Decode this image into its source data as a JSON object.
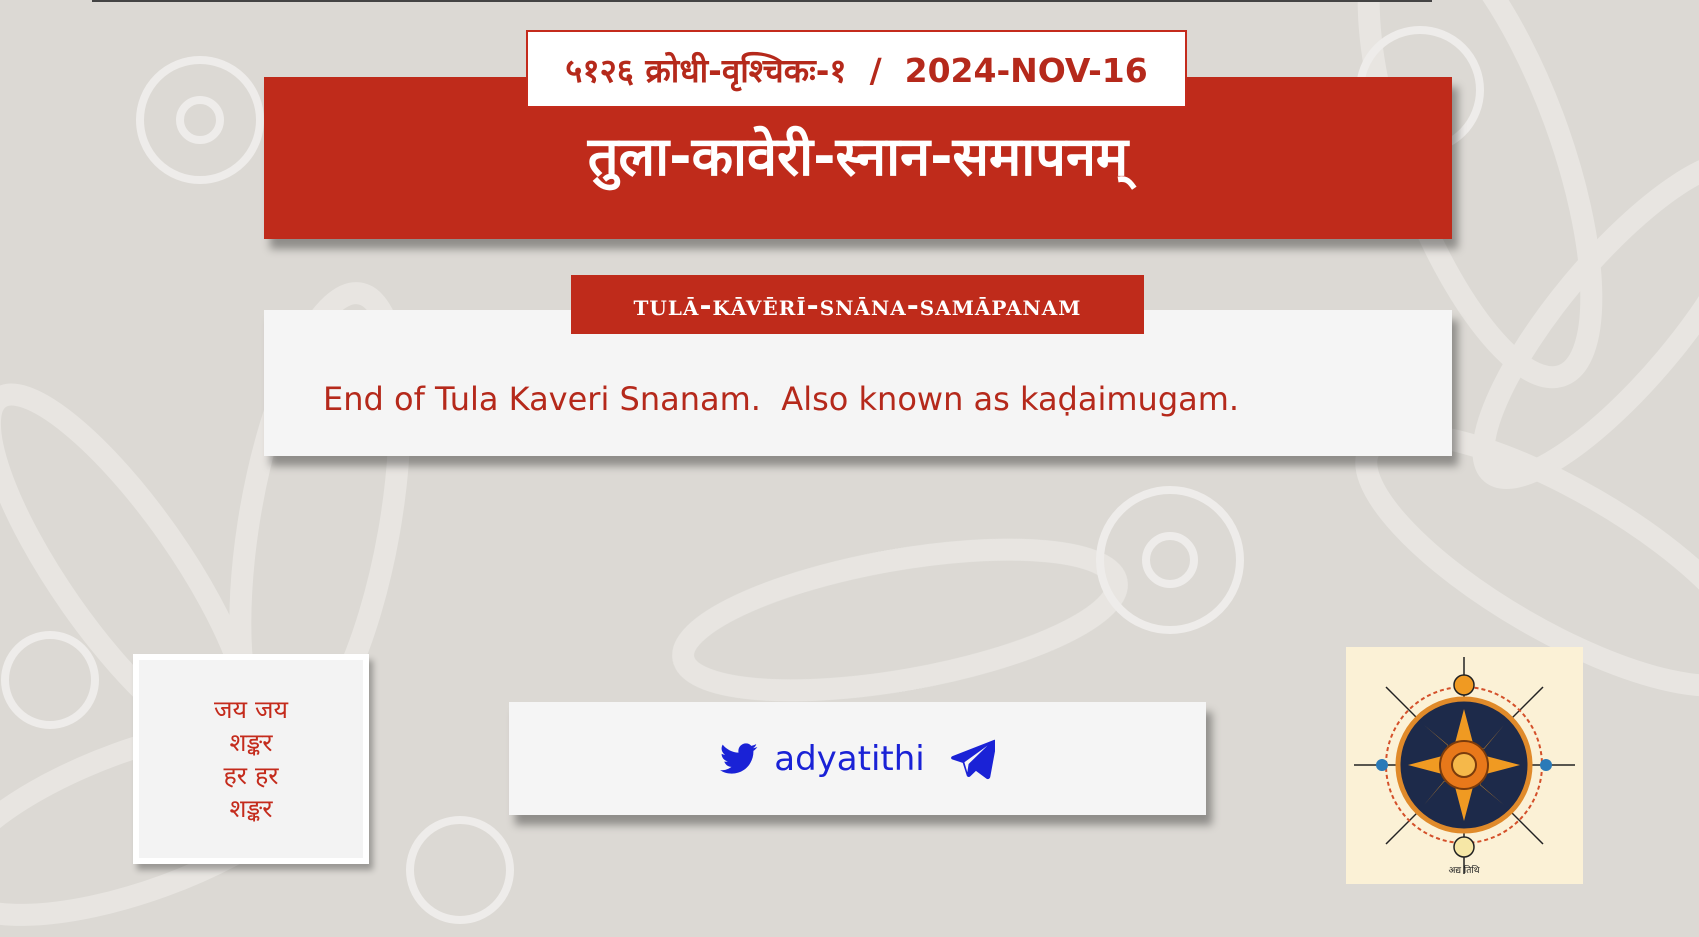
{
  "header": {
    "date_line": "५१२६ क्रोधी-वृश्चिकः-१  /  2024-NOV-16",
    "title": "तुला-कावेरी-स्नान-समापनम्"
  },
  "card": {
    "transliteration": "TULĀ-KĀVĒRĪ-SNĀNA-SAMĀPANAM",
    "description": "End of Tula Kaveri Snanam.  Also known as kaḍaimugam."
  },
  "blessing": {
    "lines": [
      "जय जय",
      "शङ्कर",
      "हर हर",
      "शङ्कर"
    ]
  },
  "social": {
    "handle": "adyatithi",
    "icons": [
      "twitter-icon",
      "telegram-icon"
    ],
    "color": "#1a22d6"
  },
  "logo": {
    "caption": "अद्य तिथि"
  },
  "colors": {
    "accent": "#bf2b1b",
    "background": "#dcd9d4",
    "card": "#f5f5f5"
  }
}
